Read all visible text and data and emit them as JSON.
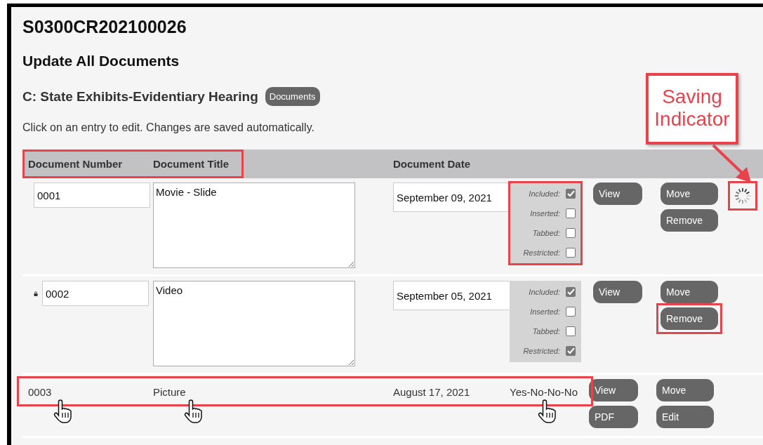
{
  "case_number": "S0300CR202100026",
  "page_title": "Update All Documents",
  "section": {
    "title": "C: State Exhibits-Evidentiary Hearing",
    "badge": "Documents"
  },
  "instructions": "Click on an entry to edit. Changes are saved automatically.",
  "table": {
    "columns": [
      "Document Number",
      "Document Title",
      "Document Date"
    ],
    "rows": [
      {
        "kind": "edit",
        "locked": false,
        "number": "0001",
        "title": "Movie - Slide",
        "date": "September 09, 2021",
        "saving": true,
        "flags": [
          {
            "label": "Included:",
            "checked": true
          },
          {
            "label": "Inserted:",
            "checked": false
          },
          {
            "label": "Tabbed:",
            "checked": false
          },
          {
            "label": "Restricted:",
            "checked": false
          }
        ],
        "buttons": [
          "View",
          "Move",
          "Remove"
        ]
      },
      {
        "kind": "edit",
        "locked": true,
        "number": "0002",
        "title": "Video",
        "date": "September 05, 2021",
        "saving": false,
        "flags": [
          {
            "label": "Included:",
            "checked": true
          },
          {
            "label": "Inserted:",
            "checked": false
          },
          {
            "label": "Tabbed:",
            "checked": false
          },
          {
            "label": "Restricted:",
            "checked": true
          }
        ],
        "buttons": [
          "View",
          "Move",
          "Remove"
        ]
      },
      {
        "kind": "display",
        "number": "0003",
        "title": "Picture",
        "date": "August 17, 2021",
        "flags_text": "Yes-No-No-No",
        "buttons": [
          "View",
          "Move",
          "PDF",
          "Edit"
        ]
      }
    ]
  },
  "annotation": {
    "callout": "Saving Indicator"
  }
}
